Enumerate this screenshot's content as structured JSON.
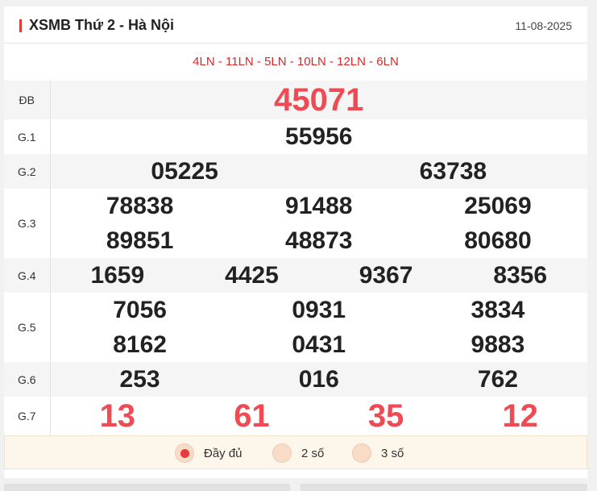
{
  "header": {
    "title": "XSMB Thứ 2 - Hà Nội",
    "date": "11-08-2025"
  },
  "codes": "4LN - 11LN - 5LN - 10LN - 12LN - 6LN",
  "prizes": [
    {
      "label": "ĐB",
      "rows": [
        [
          "45071"
        ]
      ]
    },
    {
      "label": "G.1",
      "rows": [
        [
          "55956"
        ]
      ]
    },
    {
      "label": "G.2",
      "rows": [
        [
          "05225",
          "63738"
        ]
      ]
    },
    {
      "label": "G.3",
      "rows": [
        [
          "78838",
          "91488",
          "25069"
        ],
        [
          "89851",
          "48873",
          "80680"
        ]
      ]
    },
    {
      "label": "G.4",
      "rows": [
        [
          "1659",
          "4425",
          "9367",
          "8356"
        ]
      ]
    },
    {
      "label": "G.5",
      "rows": [
        [
          "7056",
          "0931",
          "3834"
        ],
        [
          "8162",
          "0431",
          "9883"
        ]
      ]
    },
    {
      "label": "G.6",
      "rows": [
        [
          "253",
          "016",
          "762"
        ]
      ]
    },
    {
      "label": "G.7",
      "rows": [
        [
          "13",
          "61",
          "35",
          "12"
        ]
      ]
    }
  ],
  "options": [
    {
      "label": "Đầy đủ",
      "selected": true
    },
    {
      "label": "2 số",
      "selected": false
    },
    {
      "label": "3 số",
      "selected": false
    }
  ],
  "colors": {
    "accent": "#e53935",
    "highlight_number": "#ef4b55",
    "code_text": "#d62828"
  }
}
